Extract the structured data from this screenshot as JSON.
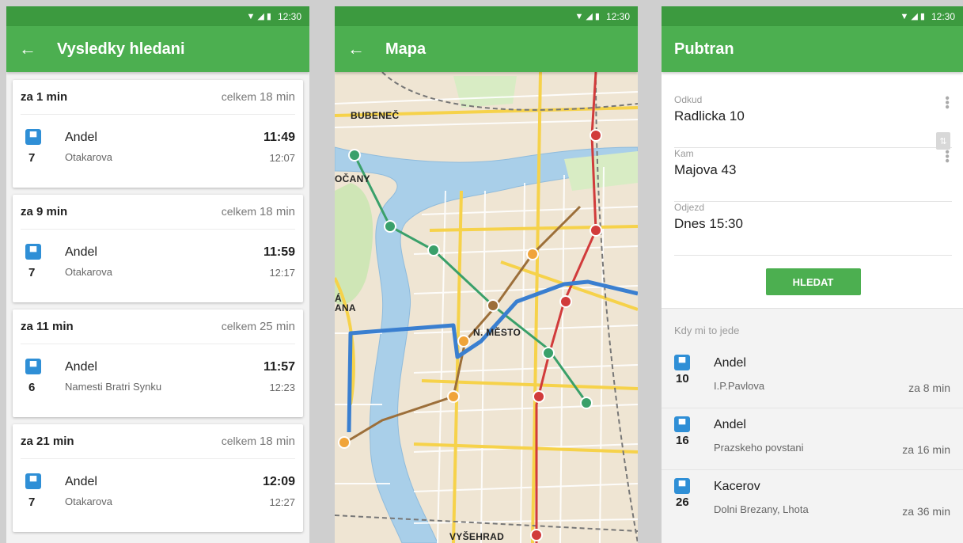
{
  "status": {
    "time": "12:30"
  },
  "results_screen": {
    "title": "Vysledky hledani",
    "cards": [
      {
        "when": "za 1 min",
        "total_prefix": "celkem",
        "total": "18 min",
        "line": "7",
        "from": "Andel",
        "to": "Otakarova",
        "dep": "11:49",
        "arr": "12:07"
      },
      {
        "when": "za 9 min",
        "total_prefix": "celkem",
        "total": "18 min",
        "line": "7",
        "from": "Andel",
        "to": "Otakarova",
        "dep": "11:59",
        "arr": "12:17"
      },
      {
        "when": "za 11 min",
        "total_prefix": "celkem",
        "total": "25 min",
        "line": "6",
        "from": "Andel",
        "to": "Namesti Bratri Synku",
        "dep": "11:57",
        "arr": "12:23"
      },
      {
        "when": "za 21 min",
        "total_prefix": "celkem",
        "total": "18 min",
        "line": "7",
        "from": "Andel",
        "to": "Otakarova",
        "dep": "12:09",
        "arr": "12:27"
      }
    ]
  },
  "map_screen": {
    "title": "Mapa",
    "labels": {
      "bubenec": "BUBENEČ",
      "holesovice": "OČANY",
      "mala": "Á\nANA",
      "nove_mesto": "N. MĚSTO",
      "vysehrad": "VYŠEHRAD"
    }
  },
  "search_screen": {
    "title": "Pubtran",
    "from_label": "Odkud",
    "from_value": "Radlicka 10",
    "to_label": "Kam",
    "to_value": "Majova 43",
    "time_label": "Odjezd",
    "time_value": "Dnes 15:30",
    "search_button": "HLEDAT",
    "departures_title": "Kdy mi to jede",
    "departures": [
      {
        "line": "10",
        "stop": "Andel",
        "direction": "I.P.Pavlova",
        "eta": "za 8 min"
      },
      {
        "line": "16",
        "stop": "Andel",
        "direction": "Prazskeho povstani",
        "eta": "za 16 min"
      },
      {
        "line": "26",
        "stop": "Kacerov",
        "direction": "Dolni Brezany, Lhota",
        "eta": "za 36 min"
      }
    ]
  },
  "colors": {
    "primary": "#4caf50",
    "status_bar": "#3c9a3f",
    "bus": "#2f8fd6",
    "route": "#3a7fd0",
    "river": "#a9cfe9"
  }
}
